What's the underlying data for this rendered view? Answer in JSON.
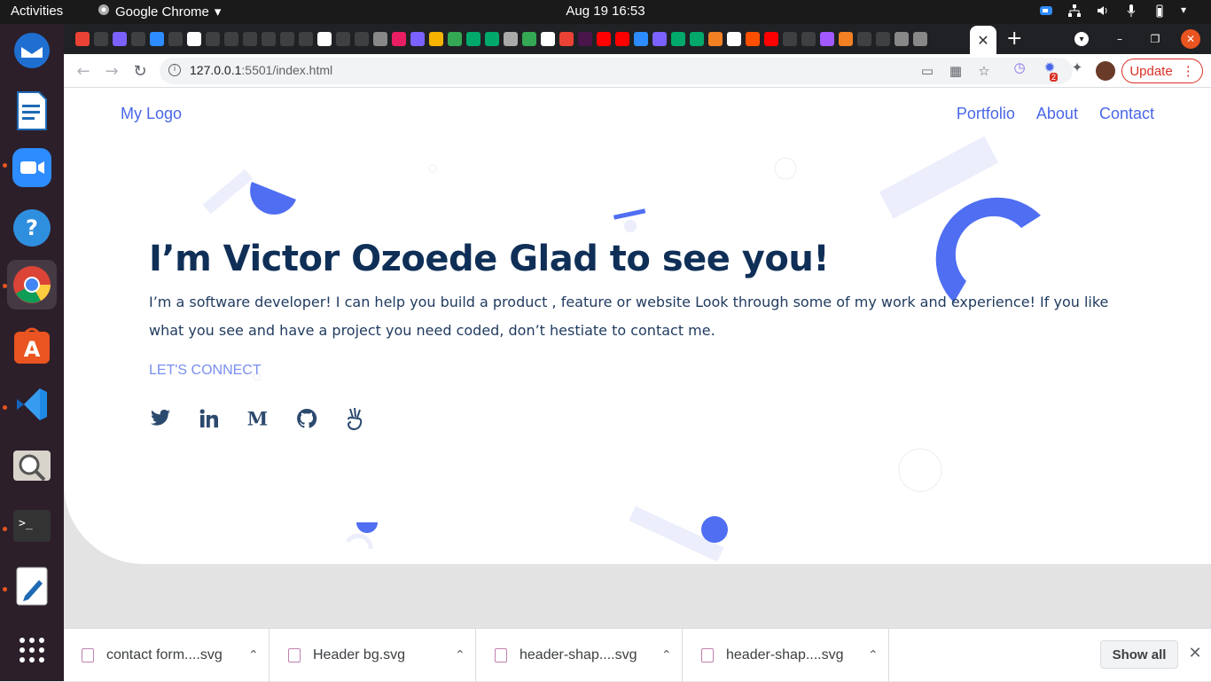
{
  "system": {
    "activities": "Activities",
    "app_menu": "Google Chrome",
    "clock": "Aug 19  16:53"
  },
  "dock": {
    "items": [
      "thunderbird-icon",
      "libreoffice-writer-icon",
      "zoom-icon",
      "help-icon",
      "chrome-icon",
      "app-store-icon",
      "vscode-icon",
      "image-viewer-icon",
      "terminal-icon",
      "text-editor-icon",
      "apps-grid-icon"
    ]
  },
  "browser": {
    "url_host": "127.0.0.1",
    "url_rest": ":5501/index.html",
    "update_label": "Update",
    "extension_badge": "2"
  },
  "page": {
    "logo": "My Logo",
    "nav": [
      "Portfolio",
      "About",
      "Contact"
    ],
    "title": "I’m Victor Ozoede Glad to see you!",
    "description": "I’m a software developer! I can help you build a product , feature or website Look through some of my work and experience! If you like what you see and have a project you need coded, don’t hestiate to contact me.",
    "cta": "LET'S CONNECT",
    "socials": [
      "twitter-icon",
      "linkedin-icon",
      "medium-icon",
      "github-icon",
      "angellist-icon"
    ],
    "colors": {
      "accent": "#4a67e8",
      "heading": "#0f2f57",
      "shape_light": "#eceefc"
    }
  },
  "downloads": {
    "items": [
      "contact form....svg",
      "Header bg.svg",
      "header-shap....svg",
      "header-shap....svg"
    ],
    "show_all": "Show all"
  }
}
